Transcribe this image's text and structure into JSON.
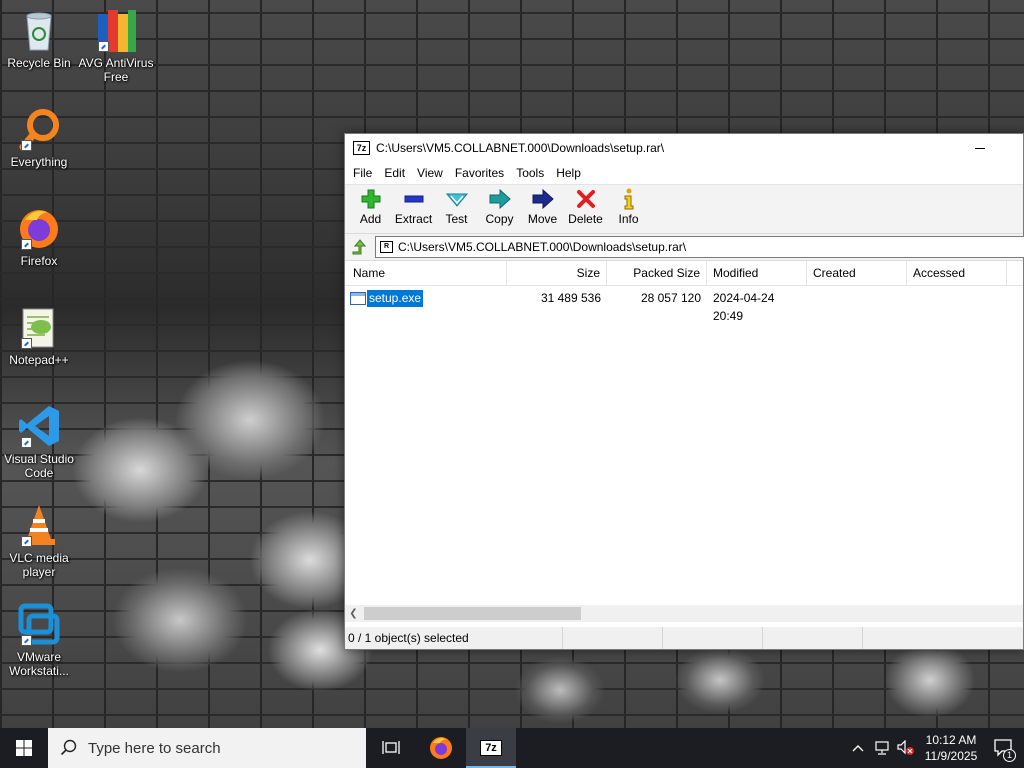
{
  "desktop": {
    "icons": [
      {
        "label": "Recycle Bin"
      },
      {
        "label": "AVG AntiVirus Free"
      },
      {
        "label": "Everything"
      },
      {
        "label": "Firefox"
      },
      {
        "label": "Notepad++"
      },
      {
        "label": "Visual Studio Code"
      },
      {
        "label": "VLC media player"
      },
      {
        "label": "VMware Workstati..."
      }
    ]
  },
  "window": {
    "app_badge": "7z",
    "title": "C:\\Users\\VM5.COLLABNET.000\\Downloads\\setup.rar\\",
    "menu": [
      "File",
      "Edit",
      "View",
      "Favorites",
      "Tools",
      "Help"
    ],
    "toolbar": [
      {
        "label": "Add",
        "icon": "plus-icon"
      },
      {
        "label": "Extract",
        "icon": "minus-icon"
      },
      {
        "label": "Test",
        "icon": "check-icon"
      },
      {
        "label": "Copy",
        "icon": "copy-arrow-icon"
      },
      {
        "label": "Move",
        "icon": "move-arrow-icon"
      },
      {
        "label": "Delete",
        "icon": "delete-x-icon"
      },
      {
        "label": "Info",
        "icon": "info-icon"
      }
    ],
    "address_badge": "R",
    "address": "C:\\Users\\VM5.COLLABNET.000\\Downloads\\setup.rar\\",
    "columns": [
      "Name",
      "Size",
      "Packed Size",
      "Modified",
      "Created",
      "Accessed"
    ],
    "files": [
      {
        "name": "setup.exe",
        "size": "31 489 536",
        "packed_size": "28 057 120",
        "modified": "2024-04-24 20:49",
        "created": "",
        "accessed": ""
      }
    ],
    "status": "0 / 1 object(s) selected"
  },
  "taskbar": {
    "search_placeholder": "Type here to search",
    "time": "10:12 AM",
    "date": "11/9/2025",
    "notification_count": "1",
    "active_app_badge": "7z"
  },
  "colors": {
    "selection": "#0078d7",
    "taskbar": "#1b1d22"
  }
}
